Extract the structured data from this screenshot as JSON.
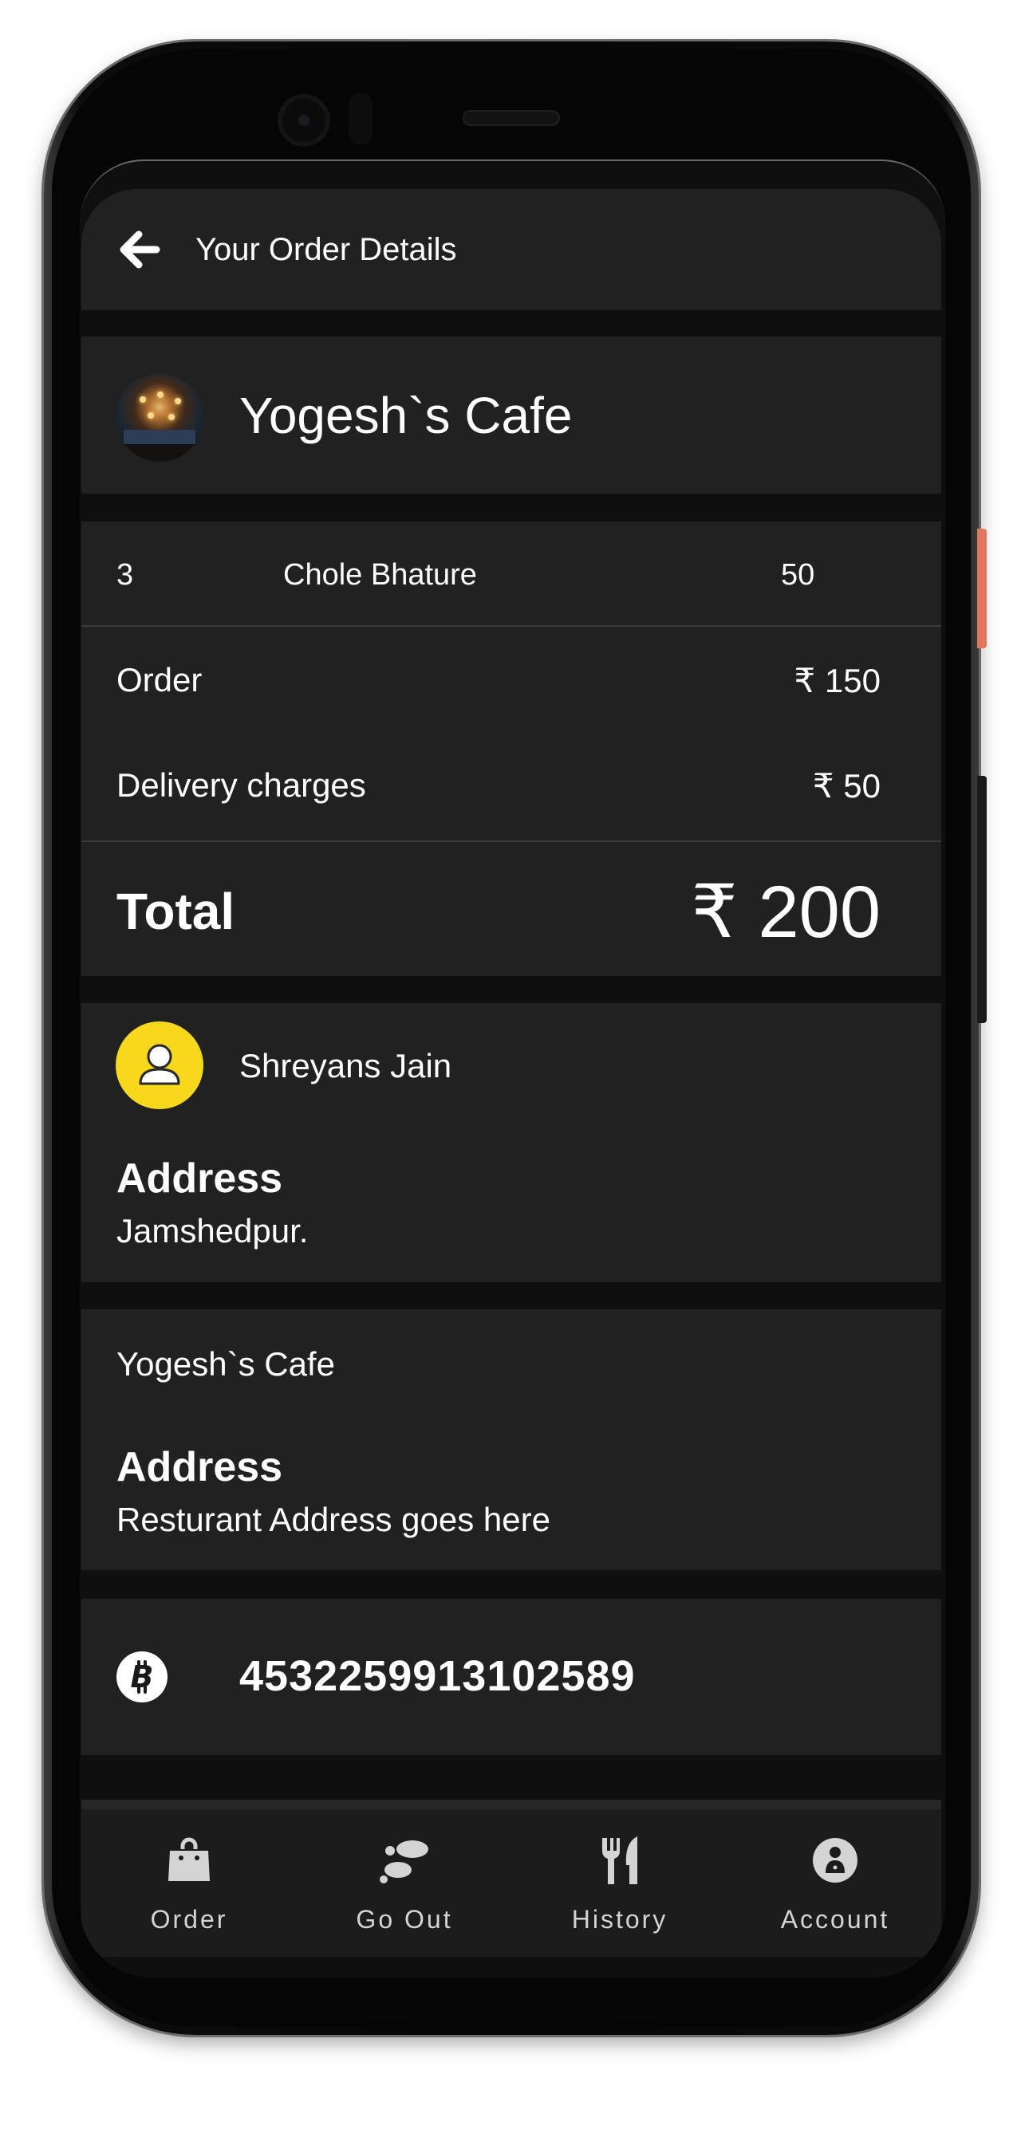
{
  "appbar": {
    "title": "Your Order Details"
  },
  "restaurant": {
    "name": "Yogesh`s Cafe"
  },
  "order": {
    "items": [
      {
        "qty": "3",
        "name": "Chole Bhature",
        "price": "50"
      }
    ],
    "order_label": "Order",
    "order_value": "₹ 150",
    "delivery_label": "Delivery charges",
    "delivery_value": "₹ 50",
    "total_label": "Total",
    "total_value": "₹ 200"
  },
  "customer": {
    "name": "Shreyans Jain",
    "address_heading": "Address",
    "address": "Jamshedpur."
  },
  "restaurant_info": {
    "name": "Yogesh`s Cafe",
    "address_heading": "Address",
    "address": "Resturant Address goes here"
  },
  "payment": {
    "icon": "bitcoin-icon",
    "number": "4532259913102589"
  },
  "bottom_nav": {
    "items": [
      {
        "label": "Order",
        "icon": "shopping-bag-icon"
      },
      {
        "label": "Go Out",
        "icon": "footprints-icon"
      },
      {
        "label": "History",
        "icon": "fork-knife-icon"
      },
      {
        "label": "Account",
        "icon": "account-icon"
      }
    ]
  },
  "colors": {
    "screen_bg": "#0f0f0f",
    "card_bg": "#212121",
    "text": "#ffffff",
    "avatar_yellow": "#f7d81c",
    "nav_icon": "#d4d4d4"
  }
}
